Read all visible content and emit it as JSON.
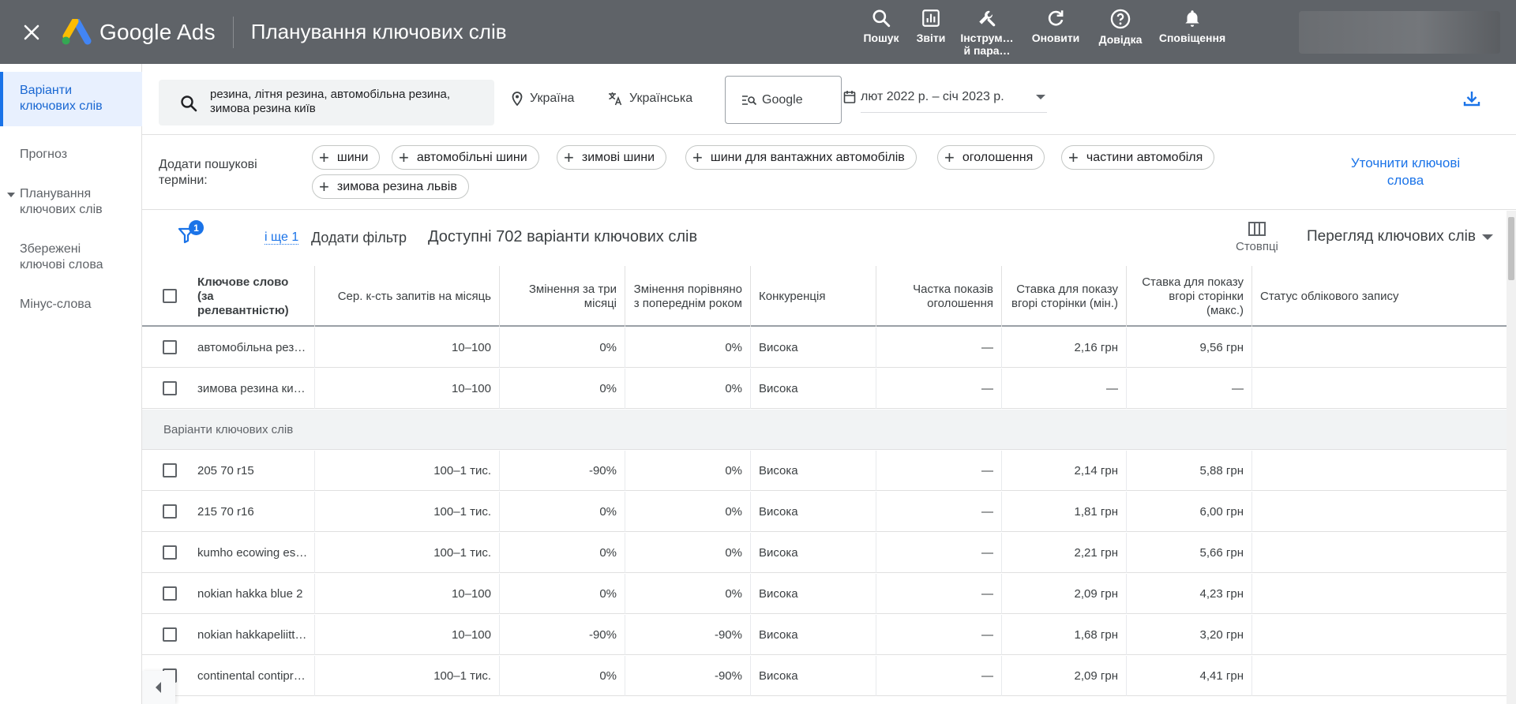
{
  "topbar": {
    "app_name": "Google Ads",
    "page_title": "Планування ключових слів",
    "tools": [
      {
        "icon": "search-icon",
        "label": "Пошук"
      },
      {
        "icon": "reports-icon",
        "label": "Звіти"
      },
      {
        "icon": "wrench-icon",
        "label": "Інструм…\nй пара…"
      },
      {
        "icon": "refresh-icon",
        "label": "Оновити"
      },
      {
        "icon": "help-icon",
        "label": "Довідка"
      },
      {
        "icon": "bell-icon",
        "label": "Сповіщення"
      }
    ]
  },
  "sidenav": {
    "items": [
      {
        "label": "Варіанти ключових слів",
        "active": true
      },
      {
        "label": "Прогноз"
      },
      {
        "label": "Планування ключових слів",
        "expandable": true
      },
      {
        "label": "Збережені ключові слова"
      },
      {
        "label": "Мінус-слова"
      }
    ]
  },
  "search": {
    "query": "резина, літня резина, автомобільна резина, зимова резина київ",
    "location": "Україна",
    "language": "Українська",
    "network": "Google",
    "date_range": "лют 2022 р. – січ 2023 р."
  },
  "chips": {
    "label": "Додати пошукові терміни:",
    "items": [
      "шини",
      "автомобільні шини",
      "зимові шини",
      "шини для вантажних автомобілів",
      "оголошення",
      "частини автомобіля",
      "зимова резина львів"
    ],
    "refine": "Уточнити ключові слова"
  },
  "toolbar": {
    "filter_count": "1",
    "more_link": "і ще 1",
    "add_filter": "Додати фільтр",
    "available": "Доступні 702 варіанти ключових слів",
    "columns_label": "Стовпці",
    "view_label": "Перегляд ключових слів"
  },
  "table": {
    "headers": [
      "Ключове слово (за релевантністю)",
      "Сер. к-сть запитів на місяць",
      "Змінення за три місяці",
      "Змінення порівняно з попереднім роком",
      "Конкуренція",
      "Частка показів оголошення",
      "Ставка для показу вгорі сторінки (мін.)",
      "Ставка для показу вгорі сторінки (макс.)",
      "Статус облікового запису"
    ],
    "provided_rows": [
      [
        "автомобільна рез…",
        "10–100",
        "0%",
        "0%",
        "Висока",
        "—",
        "2,16 грн",
        "9,56 грн",
        ""
      ],
      [
        "зимова резина ки…",
        "10–100",
        "0%",
        "0%",
        "Висока",
        "—",
        "—",
        "—",
        ""
      ]
    ],
    "section_label": "Варіанти ключових слів",
    "idea_rows": [
      [
        "205 70 r15",
        "100–1 тис.",
        "-90%",
        "0%",
        "Висока",
        "—",
        "2,14 грн",
        "5,88 грн",
        ""
      ],
      [
        "215 70 r16",
        "100–1 тис.",
        "0%",
        "0%",
        "Висока",
        "—",
        "1,81 грн",
        "6,00 грн",
        ""
      ],
      [
        "kumho ecowing es…",
        "100–1 тис.",
        "0%",
        "0%",
        "Висока",
        "—",
        "2,21 грн",
        "5,66 грн",
        ""
      ],
      [
        "nokian hakka blue 2",
        "10–100",
        "0%",
        "0%",
        "Висока",
        "—",
        "2,09 грн",
        "4,23 грн",
        ""
      ],
      [
        "nokian hakkapeliitt…",
        "10–100",
        "-90%",
        "-90%",
        "Висока",
        "—",
        "1,68 грн",
        "3,20 грн",
        ""
      ],
      [
        "continental contipr…",
        "100–1 тис.",
        "0%",
        "-90%",
        "Висока",
        "—",
        "2,09 грн",
        "4,41 грн",
        ""
      ]
    ]
  },
  "colors": {
    "topbar": "#5f6368",
    "accent": "#1a73e8",
    "active_nav_bg": "#e8f0fe"
  }
}
